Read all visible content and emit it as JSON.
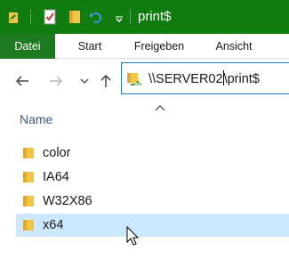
{
  "window": {
    "title": "print$"
  },
  "quick_access": {
    "icons": [
      "pin-icon",
      "properties-check-icon",
      "new-folder-icon",
      "undo-icon",
      "customize-dropdown-icon"
    ]
  },
  "ribbon": {
    "tabs": [
      {
        "label": "Datei",
        "active": true
      },
      {
        "label": "Start"
      },
      {
        "label": "Freigeben"
      },
      {
        "label": "Ansicht"
      }
    ]
  },
  "address_bar": {
    "path_before_caret": "\\\\SERVER02",
    "path_after_caret": "\\print$"
  },
  "list": {
    "column_header": "Name",
    "items": [
      {
        "label": "color"
      },
      {
        "label": "IA64"
      },
      {
        "label": "W32X86"
      },
      {
        "label": "x64",
        "selected": true
      }
    ]
  },
  "colors": {
    "titlebar": "#107c10",
    "file_tab": "#1e7a1e",
    "selection": "#cce8ff",
    "address_border": "#1d7bd4",
    "folder": "#f4c447"
  }
}
